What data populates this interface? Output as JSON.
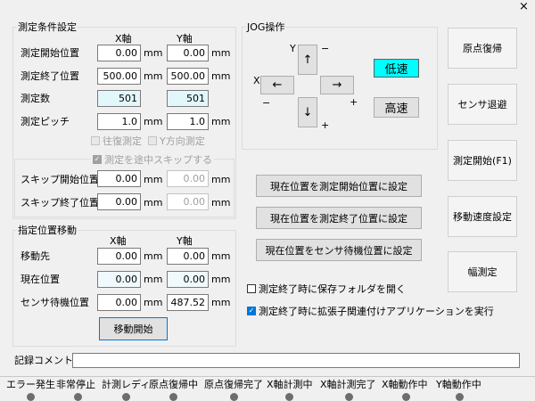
{
  "window": {
    "close_glyph": "×"
  },
  "measure_cond": {
    "title": "測定条件設定",
    "header_x": "X軸",
    "header_y": "Y軸",
    "rows": [
      {
        "label": "測定開始位置",
        "x": "0.00",
        "y": "0.00",
        "unit": "mm"
      },
      {
        "label": "測定終了位置",
        "x": "500.00",
        "y": "500.00",
        "unit": "mm"
      },
      {
        "label": "測定数",
        "x": "501",
        "y": "501",
        "unit": ""
      },
      {
        "label": "測定ピッチ",
        "x": "1.0",
        "y": "1.0",
        "unit": "mm"
      }
    ],
    "reciprocal": "往復測定",
    "y_direction": "Y方向測定"
  },
  "skip": {
    "title": "測定を途中スキップする",
    "rows": [
      {
        "label": "スキップ開始位置",
        "x": "0.00",
        "y": "0.00",
        "unit": "mm"
      },
      {
        "label": "スキップ終了位置",
        "x": "0.00",
        "y": "0.00",
        "unit": "mm"
      }
    ]
  },
  "jog": {
    "title": "JOG操作",
    "y_label": "Y",
    "x_label": "X",
    "minus": "−",
    "plus": "+",
    "up": "↑",
    "down": "↓",
    "left": "←",
    "right": "→",
    "low_speed": "低速",
    "high_speed": "高速"
  },
  "set_buttons": {
    "set_start": "現在位置を測定開始位置に設定",
    "set_end": "現在位置を測定終了位置に設定",
    "set_sensor": "現在位置をセンサ待機位置に設定"
  },
  "move": {
    "title": "指定位置移動",
    "header_x": "X軸",
    "header_y": "Y軸",
    "rows": [
      {
        "label": "移動先",
        "x": "0.00",
        "y": "0.00",
        "unit": "mm"
      },
      {
        "label": "現在位置",
        "x": "0.00",
        "y": "0.00",
        "unit": "mm"
      },
      {
        "label": "センサ待機位置",
        "x": "0.00",
        "y": "487.52",
        "unit": "mm"
      }
    ],
    "start_button": "移動開始"
  },
  "options": {
    "save_folder": {
      "label": "測定終了時に保存フォルダを開く",
      "checked": false
    },
    "run_app": {
      "label": "測定終了時に拡張子関連付けアプリケーションを実行",
      "checked": true
    },
    "check_glyph": "✓"
  },
  "side_buttons": {
    "origin": "原点復帰",
    "sensor_retract": "センサ退避",
    "measure_start": "測定開始(F1)",
    "move_speed": "移動速度設定",
    "width_measure": "幅測定"
  },
  "comment": {
    "label": "記録コメント:"
  },
  "status": [
    {
      "label": "エラー発生"
    },
    {
      "label": "非常停止"
    },
    {
      "label": "計測レディ"
    },
    {
      "label": "原点復帰中"
    },
    {
      "label": "原点復帰完了"
    },
    {
      "label": "X軸計測中"
    },
    {
      "label": "X軸計測完了"
    },
    {
      "label": "X軸動作中"
    },
    {
      "label": "Y軸動作中"
    }
  ]
}
